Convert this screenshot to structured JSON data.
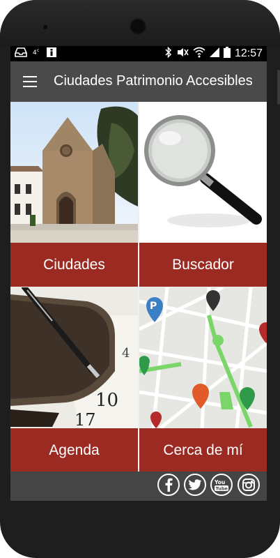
{
  "status_bar": {
    "time": "12:57",
    "left_icons": [
      "inbox-tray-icon",
      "signal-4g-icon",
      "info-icon"
    ],
    "right_icons": [
      "bluetooth-icon",
      "mute-icon",
      "wifi-icon",
      "cell-signal-icon",
      "battery-icon"
    ]
  },
  "app_bar": {
    "title": "Ciudades Patrimonio Accesibles",
    "menu_icon": "hamburger-menu-icon"
  },
  "tiles": [
    {
      "label": "Ciudades",
      "image": "stone-church-photo"
    },
    {
      "label": "Buscador",
      "image": "magnifying-glass-photo"
    },
    {
      "label": "Agenda",
      "image": "planner-and-pen-photo"
    },
    {
      "label": "Cerca de mí",
      "image": "city-map-with-pins-image"
    }
  ],
  "social_links": [
    "facebook-icon",
    "twitter-icon",
    "youtube-icon",
    "instagram-icon"
  ],
  "colors": {
    "tile_label_bg": "#9b2a22",
    "app_bar_bg": "#4a4a4a",
    "footer_bg": "#454545"
  }
}
